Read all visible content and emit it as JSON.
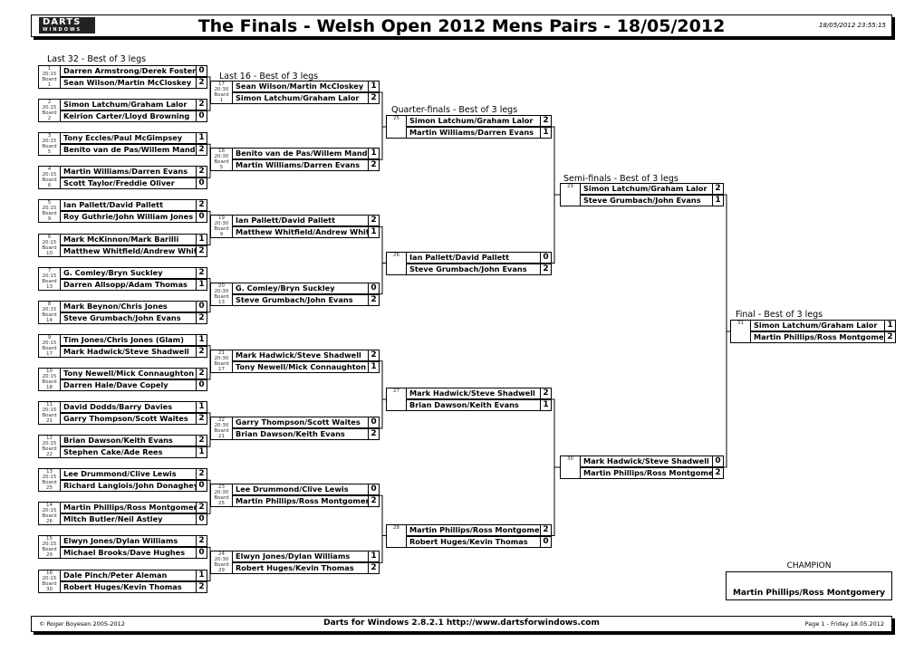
{
  "header": {
    "logo_text": "DARTS",
    "logo_sub": "WINDOWS",
    "title": "The Finals - Welsh Open 2012 Mens Pairs - 18/05/2012",
    "timestamp": "18/05/2012 23:55:15"
  },
  "rounds": [
    {
      "label": "Last 32 - Best of 3 legs",
      "matches": [
        {
          "num": "1",
          "time": "20:15",
          "board_label": "Board",
          "board": "1",
          "players": [
            {
              "name": "Darren Armstrong/Derek Foster",
              "score": "0"
            },
            {
              "name": "Sean Wilson/Martin McCloskey",
              "score": "2"
            }
          ]
        },
        {
          "num": "2",
          "time": "20:15",
          "board_label": "Board",
          "board": "2",
          "players": [
            {
              "name": "Simon Latchum/Graham Lalor",
              "score": "2"
            },
            {
              "name": "Keirion Carter/Lloyd Browning",
              "score": "0"
            }
          ]
        },
        {
          "num": "3",
          "time": "20:15",
          "board_label": "Board",
          "board": "5",
          "players": [
            {
              "name": "Tony Eccles/Paul McGimpsey",
              "score": "1"
            },
            {
              "name": "Benito van de Pas/Willem Mandic",
              "score": "2"
            }
          ]
        },
        {
          "num": "4",
          "time": "20:15",
          "board_label": "Board",
          "board": "6",
          "players": [
            {
              "name": "Martin Williams/Darren Evans",
              "score": "2"
            },
            {
              "name": "Scott Taylor/Freddie Oliver",
              "score": "0"
            }
          ]
        },
        {
          "num": "5",
          "time": "20:15",
          "board_label": "Board",
          "board": "9",
          "players": [
            {
              "name": "Ian Pallett/David Pallett",
              "score": "2"
            },
            {
              "name": "Roy Guthrie/John William Jones",
              "score": "0"
            }
          ]
        },
        {
          "num": "6",
          "time": "20:15",
          "board_label": "Board",
          "board": "10",
          "players": [
            {
              "name": "Mark McKinnon/Mark Barilli",
              "score": "1"
            },
            {
              "name": "Matthew Whitfield/Andrew Whitf",
              "score": "2"
            }
          ]
        },
        {
          "num": "7",
          "time": "20:15",
          "board_label": "Board",
          "board": "13",
          "players": [
            {
              "name": "G. Comley/Bryn Suckley",
              "score": "2"
            },
            {
              "name": "Darren Allsopp/Adam Thomas",
              "score": "1"
            }
          ]
        },
        {
          "num": "8",
          "time": "20:15",
          "board_label": "Board",
          "board": "14",
          "players": [
            {
              "name": "Mark Beynon/Chris Jones",
              "score": "0"
            },
            {
              "name": "Steve Grumbach/John Evans",
              "score": "2"
            }
          ]
        },
        {
          "num": "9",
          "time": "20:15",
          "board_label": "Board",
          "board": "17",
          "players": [
            {
              "name": "Tim Jones/Chris Jones (Glam)",
              "score": "1"
            },
            {
              "name": "Mark Hadwick/Steve Shadwell",
              "score": "2"
            }
          ]
        },
        {
          "num": "10",
          "time": "20:15",
          "board_label": "Board",
          "board": "18",
          "players": [
            {
              "name": "Tony Newell/Mick Connaughton",
              "score": "2"
            },
            {
              "name": "Darren Hale/Dave Copely",
              "score": "0"
            }
          ]
        },
        {
          "num": "11",
          "time": "20:15",
          "board_label": "Board",
          "board": "21",
          "players": [
            {
              "name": "David Dodds/Barry Davies",
              "score": "1"
            },
            {
              "name": "Garry Thompson/Scott Waites",
              "score": "2"
            }
          ]
        },
        {
          "num": "12",
          "time": "20:15",
          "board_label": "Board",
          "board": "22",
          "players": [
            {
              "name": "Brian Dawson/Keith Evans",
              "score": "2"
            },
            {
              "name": "Stephen Cake/Ade Rees",
              "score": "1"
            }
          ]
        },
        {
          "num": "13",
          "time": "20:15",
          "board_label": "Board",
          "board": "25",
          "players": [
            {
              "name": "Lee Drummond/Clive Lewis",
              "score": "2"
            },
            {
              "name": "Richard Langlois/John Donaghey",
              "score": "0"
            }
          ]
        },
        {
          "num": "14",
          "time": "20:15",
          "board_label": "Board",
          "board": "26",
          "players": [
            {
              "name": "Martin Phillips/Ross Montgomery",
              "score": "2"
            },
            {
              "name": "Mitch Butler/Neil Astley",
              "score": "0"
            }
          ]
        },
        {
          "num": "15",
          "time": "20:15",
          "board_label": "Board",
          "board": "29",
          "players": [
            {
              "name": "Elwyn Jones/Dylan Williams",
              "score": "2"
            },
            {
              "name": "Michael Brooks/Dave Hughes",
              "score": "0"
            }
          ]
        },
        {
          "num": "16",
          "time": "20:15",
          "board_label": "Board",
          "board": "30",
          "players": [
            {
              "name": "Dale Pinch/Peter Aleman",
              "score": "1"
            },
            {
              "name": "Robert Huges/Kevin Thomas",
              "score": "2"
            }
          ]
        }
      ]
    },
    {
      "label": "Last 16 - Best of 3 legs",
      "matches": [
        {
          "num": "17",
          "time": "20:30",
          "board_label": "Board",
          "board": "1",
          "players": [
            {
              "name": "Sean Wilson/Martin McCloskey",
              "score": "1"
            },
            {
              "name": "Simon Latchum/Graham Lalor",
              "score": "2"
            }
          ]
        },
        {
          "num": "18",
          "time": "20:30",
          "board_label": "Board",
          "board": "5",
          "players": [
            {
              "name": "Benito van de Pas/Willem Mandic",
              "score": "1"
            },
            {
              "name": "Martin Williams/Darren Evans",
              "score": "2"
            }
          ]
        },
        {
          "num": "19",
          "time": "20:30",
          "board_label": "Board",
          "board": "9",
          "players": [
            {
              "name": "Ian Pallett/David Pallett",
              "score": "2"
            },
            {
              "name": "Matthew Whitfield/Andrew Whitf",
              "score": "1"
            }
          ]
        },
        {
          "num": "20",
          "time": "20:30",
          "board_label": "Board",
          "board": "13",
          "players": [
            {
              "name": "G. Comley/Bryn Suckley",
              "score": "0"
            },
            {
              "name": "Steve Grumbach/John Evans",
              "score": "2"
            }
          ]
        },
        {
          "num": "21",
          "time": "20:30",
          "board_label": "Board",
          "board": "17",
          "players": [
            {
              "name": "Mark Hadwick/Steve Shadwell",
              "score": "2"
            },
            {
              "name": "Tony Newell/Mick Connaughton",
              "score": "1"
            }
          ]
        },
        {
          "num": "22",
          "time": "20:30",
          "board_label": "Board",
          "board": "21",
          "players": [
            {
              "name": "Garry Thompson/Scott Waites",
              "score": "0"
            },
            {
              "name": "Brian Dawson/Keith Evans",
              "score": "2"
            }
          ]
        },
        {
          "num": "23",
          "time": "20:30",
          "board_label": "Board",
          "board": "25",
          "players": [
            {
              "name": "Lee Drummond/Clive Lewis",
              "score": "0"
            },
            {
              "name": "Martin Phillips/Ross Montgomery",
              "score": "2"
            }
          ]
        },
        {
          "num": "24",
          "time": "20:30",
          "board_label": "Board",
          "board": "29",
          "players": [
            {
              "name": "Elwyn Jones/Dylan Williams",
              "score": "1"
            },
            {
              "name": "Robert Huges/Kevin Thomas",
              "score": "2"
            }
          ]
        }
      ]
    },
    {
      "label": "Quarter-finals - Best of 3 legs",
      "matches": [
        {
          "num": "25",
          "players": [
            {
              "name": "Simon Latchum/Graham Lalor",
              "score": "2"
            },
            {
              "name": "Martin Williams/Darren Evans",
              "score": "1"
            }
          ]
        },
        {
          "num": "26",
          "players": [
            {
              "name": "Ian Pallett/David Pallett",
              "score": "0"
            },
            {
              "name": "Steve Grumbach/John Evans",
              "score": "2"
            }
          ]
        },
        {
          "num": "27",
          "players": [
            {
              "name": "Mark Hadwick/Steve Shadwell",
              "score": "2"
            },
            {
              "name": "Brian Dawson/Keith Evans",
              "score": "1"
            }
          ]
        },
        {
          "num": "28",
          "players": [
            {
              "name": "Martin Phillips/Ross Montgomery",
              "score": "2"
            },
            {
              "name": "Robert Huges/Kevin Thomas",
              "score": "0"
            }
          ]
        }
      ]
    },
    {
      "label": "Semi-finals - Best of 3 legs",
      "matches": [
        {
          "num": "29",
          "players": [
            {
              "name": "Simon Latchum/Graham Lalor",
              "score": "2"
            },
            {
              "name": "Steve Grumbach/John Evans",
              "score": "1"
            }
          ]
        },
        {
          "num": "30",
          "players": [
            {
              "name": "Mark Hadwick/Steve Shadwell",
              "score": "0"
            },
            {
              "name": "Martin Phillips/Ross Montgomery",
              "score": "2"
            }
          ]
        }
      ]
    },
    {
      "label": "Final - Best of 3 legs",
      "matches": [
        {
          "num": "31",
          "players": [
            {
              "name": "Simon Latchum/Graham Lalor",
              "score": "1"
            },
            {
              "name": "Martin Phillips/Ross Montgomery",
              "score": "2"
            }
          ]
        }
      ]
    }
  ],
  "champion": {
    "label": "CHAMPION",
    "name": "Martin Phillips/Ross Montgomery"
  },
  "footer": {
    "copyright": "© Roger Boyesen 2005-2012",
    "product": "Darts for Windows 2.8.2.1 http://www.dartsforwindows.com",
    "page": "Page 1 - Friday 18.05.2012"
  }
}
